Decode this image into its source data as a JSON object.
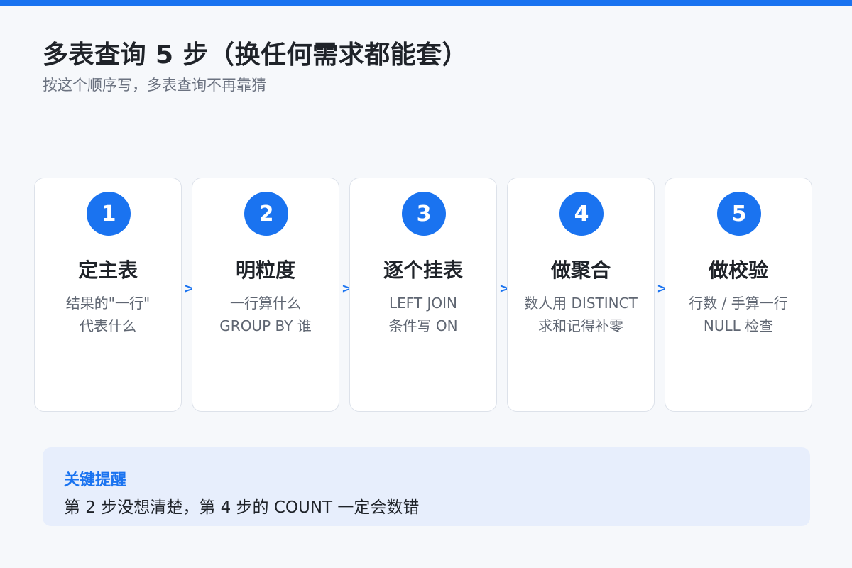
{
  "header": {
    "title": "多表查询 5 步（换任何需求都能套）",
    "subtitle": "按这个顺序写，多表查询不再靠猜"
  },
  "steps": [
    {
      "number": "1",
      "title": "定主表",
      "lines": [
        "结果的\"一行\"",
        "代表什么"
      ]
    },
    {
      "number": "2",
      "title": "明粒度",
      "lines": [
        "一行算什么",
        "GROUP BY 谁"
      ]
    },
    {
      "number": "3",
      "title": "逐个挂表",
      "lines": [
        "LEFT JOIN",
        "条件写 ON"
      ]
    },
    {
      "number": "4",
      "title": "做聚合",
      "lines": [
        "数人用 DISTINCT",
        "求和记得补零"
      ]
    },
    {
      "number": "5",
      "title": "做校验",
      "lines": [
        "行数 / 手算一行",
        "NULL 检查"
      ]
    }
  ],
  "arrow_glyph": ">",
  "tip": {
    "title": "关键提醒",
    "text": "第 2 步没想清楚，第 4 步的 COUNT 一定会数错"
  },
  "colors": {
    "accent": "#1a73f0",
    "background": "#f6f8fb",
    "tip_background": "#e7eefc"
  }
}
